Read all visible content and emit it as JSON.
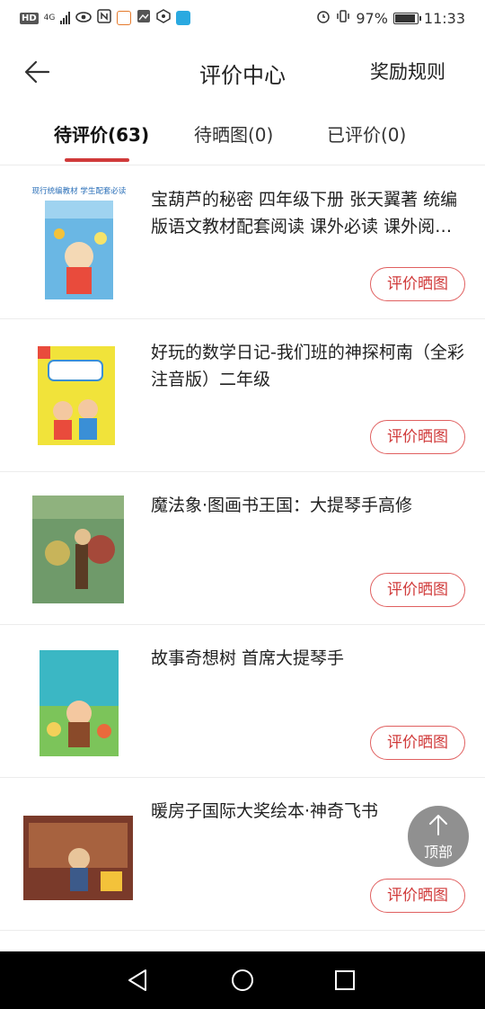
{
  "status_bar": {
    "left_badge": "HD",
    "network": "4G",
    "battery": "97%",
    "time": "11:33"
  },
  "header": {
    "title": "评价中心",
    "rules_label": "奖励规则"
  },
  "tabs": [
    {
      "label": "待评价(63)",
      "active": true
    },
    {
      "label": "待晒图(0)",
      "active": false
    },
    {
      "label": "已评价(0)",
      "active": false
    }
  ],
  "items": [
    {
      "title": "宝葫芦的秘密 四年级下册 张天翼著 统编版语文教材配套阅读 课外必读 课外阅读 课程标准",
      "button": "评价晒图",
      "cover_banner": "现行统编教材 学生配套必读"
    },
    {
      "title": "好玩的数学日记-我们班的神探柯南（全彩注音版）二年级",
      "button": "评价晒图"
    },
    {
      "title": "魔法象·图画书王国：大提琴手高修",
      "button": "评价晒图"
    },
    {
      "title": "故事奇想树 首席大提琴手",
      "button": "评价晒图"
    },
    {
      "title": "暖房子国际大奖绘本·神奇飞书",
      "button": "评价晒图"
    }
  ],
  "back_to_top_label": "顶部",
  "colors": {
    "accent": "#d03a3a",
    "divider": "#ececec"
  }
}
